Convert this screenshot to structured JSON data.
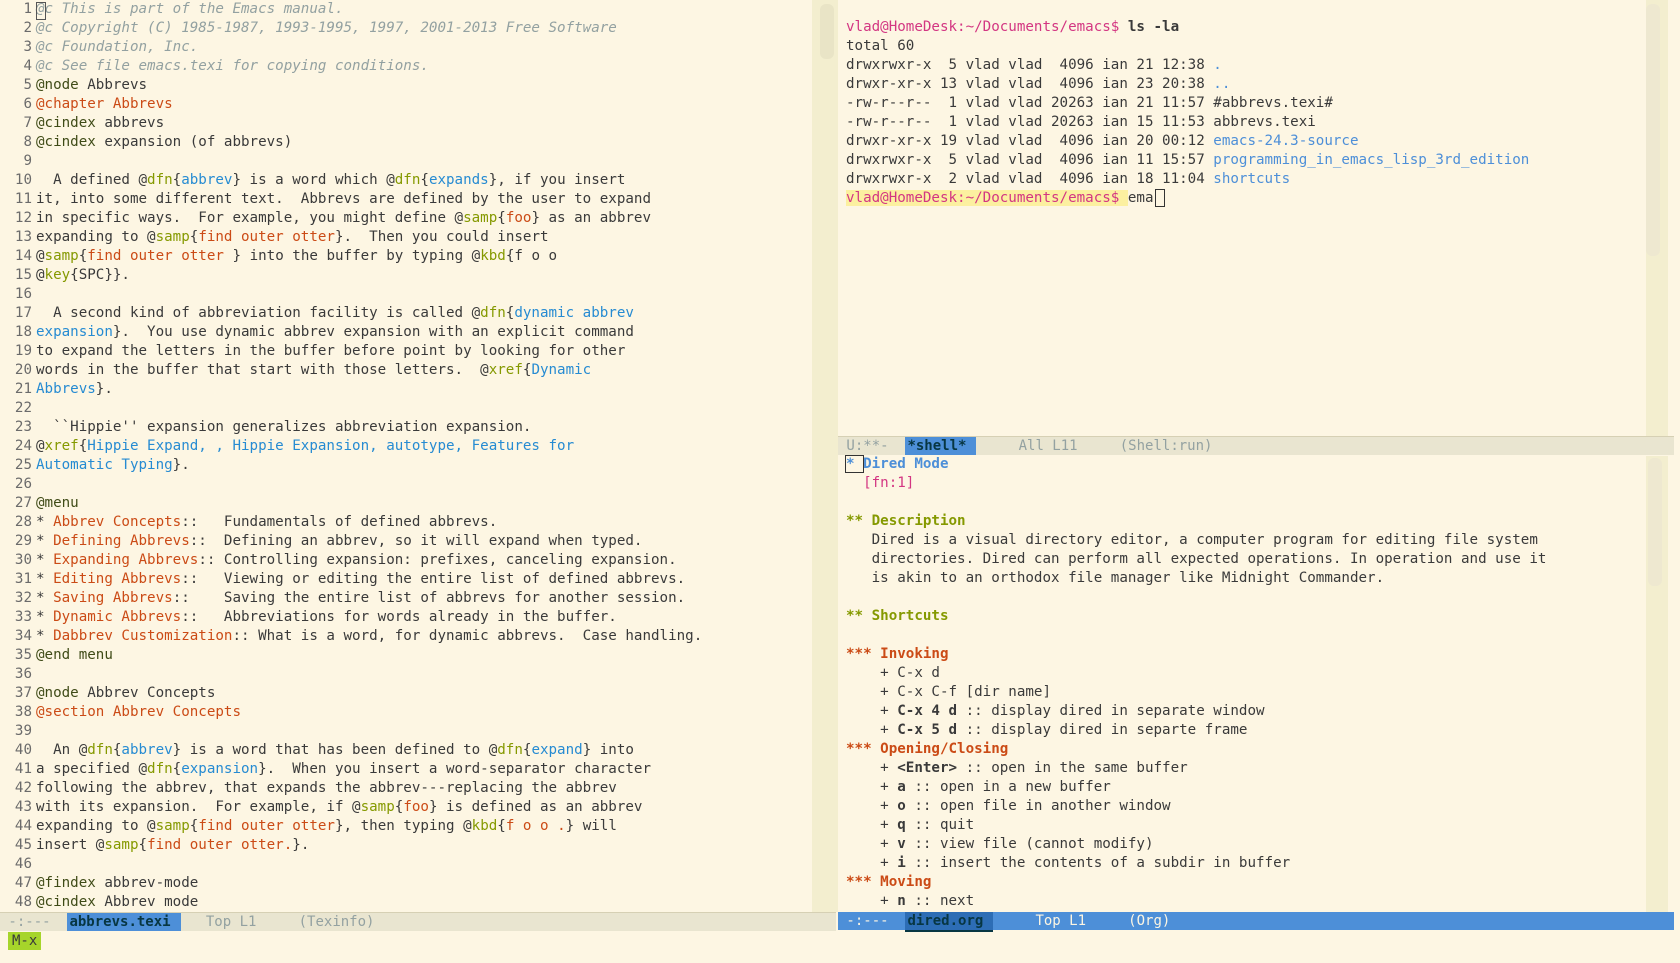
{
  "left_buffer": {
    "lines": [
      [
        {
          "t": "@c This is part of the Emacs manual.",
          "c": "c-comment"
        }
      ],
      [
        {
          "t": "@c Copyright (C) 1985-1987, 1993-1995, 1997, 2001-2013 Free Software",
          "c": "c-comment"
        }
      ],
      [
        {
          "t": "@c Foundation, Inc.",
          "c": "c-comment"
        }
      ],
      [
        {
          "t": "@c See file emacs.texi for copying conditions.",
          "c": "c-comment"
        }
      ],
      [
        {
          "t": "@node",
          "c": "c-kw"
        },
        {
          "t": " Abbrevs",
          "c": ""
        }
      ],
      [
        {
          "t": "@chapter Abbrevs",
          "c": "c-orange"
        }
      ],
      [
        {
          "t": "@cindex",
          "c": "c-kw"
        },
        {
          "t": " abbrevs",
          "c": ""
        }
      ],
      [
        {
          "t": "@cindex",
          "c": "c-kw"
        },
        {
          "t": " expansion (of abbrevs)",
          "c": ""
        }
      ],
      [
        {
          "t": "",
          "c": ""
        }
      ],
      [
        {
          "t": "  A defined @",
          "c": ""
        },
        {
          "t": "dfn",
          "c": "c-green"
        },
        {
          "t": "{",
          "c": ""
        },
        {
          "t": "abbrev",
          "c": "c-blue"
        },
        {
          "t": "} is a word which @",
          "c": ""
        },
        {
          "t": "dfn",
          "c": "c-green"
        },
        {
          "t": "{",
          "c": ""
        },
        {
          "t": "expands",
          "c": "c-blue"
        },
        {
          "t": "}, if you insert",
          "c": ""
        }
      ],
      [
        {
          "t": "it, into some different text.  Abbrevs are defined by the user to expand",
          "c": ""
        }
      ],
      [
        {
          "t": "in specific ways.  For example, you might define @",
          "c": ""
        },
        {
          "t": "samp",
          "c": "c-green"
        },
        {
          "t": "{",
          "c": ""
        },
        {
          "t": "foo",
          "c": "c-orange"
        },
        {
          "t": "} as an abbrev",
          "c": ""
        }
      ],
      [
        {
          "t": "expanding to @",
          "c": ""
        },
        {
          "t": "samp",
          "c": "c-green"
        },
        {
          "t": "{",
          "c": ""
        },
        {
          "t": "find outer otter",
          "c": "c-orange"
        },
        {
          "t": "}.  Then you could insert",
          "c": ""
        }
      ],
      [
        {
          "t": "@",
          "c": ""
        },
        {
          "t": "samp",
          "c": "c-green"
        },
        {
          "t": "{",
          "c": ""
        },
        {
          "t": "find outer otter ",
          "c": "c-orange"
        },
        {
          "t": "} into the buffer by typing @",
          "c": ""
        },
        {
          "t": "kbd",
          "c": "c-green"
        },
        {
          "t": "{f o o",
          "c": ""
        }
      ],
      [
        {
          "t": "@",
          "c": ""
        },
        {
          "t": "key",
          "c": "c-green"
        },
        {
          "t": "{SPC}}.",
          "c": ""
        }
      ],
      [
        {
          "t": "",
          "c": ""
        }
      ],
      [
        {
          "t": "  A second kind of abbreviation facility is called @",
          "c": ""
        },
        {
          "t": "dfn",
          "c": "c-green"
        },
        {
          "t": "{",
          "c": ""
        },
        {
          "t": "dynamic abbrev",
          "c": "c-blue"
        }
      ],
      [
        {
          "t": "expansion",
          "c": "c-blue"
        },
        {
          "t": "}.  You use dynamic abbrev expansion with an explicit command",
          "c": ""
        }
      ],
      [
        {
          "t": "to expand the letters in the buffer before point by looking for other",
          "c": ""
        }
      ],
      [
        {
          "t": "words in the buffer that start with those letters.  @",
          "c": ""
        },
        {
          "t": "xref",
          "c": "c-green"
        },
        {
          "t": "{",
          "c": ""
        },
        {
          "t": "Dynamic",
          "c": "c-blue"
        }
      ],
      [
        {
          "t": "Abbrevs",
          "c": "c-blue"
        },
        {
          "t": "}.",
          "c": ""
        }
      ],
      [
        {
          "t": "",
          "c": ""
        }
      ],
      [
        {
          "t": "  ``Hippie'' expansion generalizes abbreviation expansion.",
          "c": ""
        }
      ],
      [
        {
          "t": "@",
          "c": ""
        },
        {
          "t": "xref",
          "c": "c-green"
        },
        {
          "t": "{",
          "c": ""
        },
        {
          "t": "Hippie Expand, , Hippie Expansion, autotype, Features for",
          "c": "c-blue"
        }
      ],
      [
        {
          "t": "Automatic Typing",
          "c": "c-blue"
        },
        {
          "t": "}.",
          "c": ""
        }
      ],
      [
        {
          "t": "",
          "c": ""
        }
      ],
      [
        {
          "t": "@menu",
          "c": "c-kw"
        }
      ],
      [
        {
          "t": "* ",
          "c": ""
        },
        {
          "t": "Abbrev Concepts",
          "c": "c-orange"
        },
        {
          "t": "::   Fundamentals of defined abbrevs.",
          "c": ""
        }
      ],
      [
        {
          "t": "* ",
          "c": ""
        },
        {
          "t": "Defining Abbrevs",
          "c": "c-orange"
        },
        {
          "t": "::  Defining an abbrev, so it will expand when typed.",
          "c": ""
        }
      ],
      [
        {
          "t": "* ",
          "c": ""
        },
        {
          "t": "Expanding Abbrevs",
          "c": "c-orange"
        },
        {
          "t": ":: Controlling expansion: prefixes, canceling expansion.",
          "c": ""
        }
      ],
      [
        {
          "t": "* ",
          "c": ""
        },
        {
          "t": "Editing Abbrevs",
          "c": "c-orange"
        },
        {
          "t": "::   Viewing or editing the entire list of defined abbrevs.",
          "c": ""
        }
      ],
      [
        {
          "t": "* ",
          "c": ""
        },
        {
          "t": "Saving Abbrevs",
          "c": "c-orange"
        },
        {
          "t": "::    Saving the entire list of abbrevs for another session.",
          "c": ""
        }
      ],
      [
        {
          "t": "* ",
          "c": ""
        },
        {
          "t": "Dynamic Abbrevs",
          "c": "c-orange"
        },
        {
          "t": "::   Abbreviations for words already in the buffer.",
          "c": ""
        }
      ],
      [
        {
          "t": "* ",
          "c": ""
        },
        {
          "t": "Dabbrev Customization",
          "c": "c-orange"
        },
        {
          "t": ":: What is a word, for dynamic abbrevs.  Case handling.",
          "c": ""
        }
      ],
      [
        {
          "t": "@end menu",
          "c": "c-kw"
        }
      ],
      [
        {
          "t": "",
          "c": ""
        }
      ],
      [
        {
          "t": "@node",
          "c": "c-kw"
        },
        {
          "t": " Abbrev Concepts",
          "c": ""
        }
      ],
      [
        {
          "t": "@section Abbrev Concepts",
          "c": "c-orange"
        }
      ],
      [
        {
          "t": "",
          "c": ""
        }
      ],
      [
        {
          "t": "  An @",
          "c": ""
        },
        {
          "t": "dfn",
          "c": "c-green"
        },
        {
          "t": "{",
          "c": ""
        },
        {
          "t": "abbrev",
          "c": "c-blue"
        },
        {
          "t": "} is a word that has been defined to @",
          "c": ""
        },
        {
          "t": "dfn",
          "c": "c-green"
        },
        {
          "t": "{",
          "c": ""
        },
        {
          "t": "expand",
          "c": "c-blue"
        },
        {
          "t": "} into",
          "c": ""
        }
      ],
      [
        {
          "t": "a specified @",
          "c": ""
        },
        {
          "t": "dfn",
          "c": "c-green"
        },
        {
          "t": "{",
          "c": ""
        },
        {
          "t": "expansion",
          "c": "c-blue"
        },
        {
          "t": "}.  When you insert a word-separator character",
          "c": ""
        }
      ],
      [
        {
          "t": "following the abbrev, that expands the abbrev---replacing the abbrev",
          "c": ""
        }
      ],
      [
        {
          "t": "with its expansion.  For example, if @",
          "c": ""
        },
        {
          "t": "samp",
          "c": "c-green"
        },
        {
          "t": "{",
          "c": ""
        },
        {
          "t": "foo",
          "c": "c-orange"
        },
        {
          "t": "} is defined as an abbrev",
          "c": ""
        }
      ],
      [
        {
          "t": "expanding to @",
          "c": ""
        },
        {
          "t": "samp",
          "c": "c-green"
        },
        {
          "t": "{",
          "c": ""
        },
        {
          "t": "find outer otter",
          "c": "c-orange"
        },
        {
          "t": "}, then typing @",
          "c": ""
        },
        {
          "t": "kbd",
          "c": "c-green"
        },
        {
          "t": "{",
          "c": ""
        },
        {
          "t": "f o o .",
          "c": "c-orange"
        },
        {
          "t": "} will",
          "c": ""
        }
      ],
      [
        {
          "t": "insert @",
          "c": ""
        },
        {
          "t": "samp",
          "c": "c-green"
        },
        {
          "t": "{",
          "c": ""
        },
        {
          "t": "find outer otter.",
          "c": "c-orange"
        },
        {
          "t": "}.",
          "c": ""
        }
      ],
      [
        {
          "t": "",
          "c": ""
        }
      ],
      [
        {
          "t": "@findex",
          "c": "c-kw"
        },
        {
          "t": " abbrev-mode",
          "c": ""
        }
      ],
      [
        {
          "t": "@cindex",
          "c": "c-kw"
        },
        {
          "t": " Abbrev mode",
          "c": ""
        }
      ]
    ]
  },
  "left_modeline": {
    "state": " -:---  ",
    "buffer": "abbrevs.texi",
    "position": "   Top L1     ",
    "mode": "(Texinfo)"
  },
  "shell": {
    "prompt1": "vlad@HomeDesk:~/Documents/emacs$ ",
    "cmd1": "ls -la",
    "lines": [
      {
        "t": "total 60",
        "c": ""
      },
      {
        "t": "drwxrwxr-x  5 vlad vlad  4096 ian 21 12:38 ",
        "name": ".",
        "c": "c-dirblue"
      },
      {
        "t": "drwxr-xr-x 13 vlad vlad  4096 ian 23 20:38 ",
        "name": "..",
        "c": "c-dirblue"
      },
      {
        "t": "-rw-r--r--  1 vlad vlad 20263 ian 21 11:57 ",
        "name": "#abbrevs.texi#",
        "c": ""
      },
      {
        "t": "-rw-r--r--  1 vlad vlad 20263 ian 15 11:53 ",
        "name": "abbrevs.texi",
        "c": ""
      },
      {
        "t": "drwxr-xr-x 19 vlad vlad  4096 ian 20 00:12 ",
        "name": "emacs-24.3-source",
        "c": "c-dirblue"
      },
      {
        "t": "drwxrwxr-x  5 vlad vlad  4096 ian 11 15:57 ",
        "name": "programming_in_emacs_lisp_3rd_edition",
        "c": "c-dirblue"
      },
      {
        "t": "drwxrwxr-x  2 vlad vlad  4096 ian 18 11:04 ",
        "name": "shortcuts",
        "c": "c-dirblue"
      }
    ],
    "prompt2": "vlad@HomeDesk:~/Documents/emacs$ ",
    "input": "ema"
  },
  "shell_modeline": {
    "state": " U:**-  ",
    "buffer": "*shell*",
    "position": "     All L11     ",
    "mode": "(Shell:run)"
  },
  "dired_org": {
    "lines": [
      {
        "pre": "",
        "h": "* Dired Mode",
        "c": "org-h1"
      },
      {
        "pre": "  ",
        "h": "[fn:1]",
        "c": "c-magenta"
      },
      {
        "pre": "",
        "h": "",
        "c": ""
      },
      {
        "pre": "",
        "h": "** Description",
        "c": "org-h2"
      },
      {
        "pre": "   Dired is a visual directory editor, a computer program for editing file system",
        "h": "",
        "c": ""
      },
      {
        "pre": "   directories. Dired can perform all expected operations. In operation and use it",
        "h": "",
        "c": ""
      },
      {
        "pre": "   is akin to an orthodox file manager like Midnight Commander.",
        "h": "",
        "c": ""
      },
      {
        "pre": "",
        "h": "",
        "c": ""
      },
      {
        "pre": "",
        "h": "** Shortcuts",
        "c": "org-h2"
      },
      {
        "pre": "",
        "h": "",
        "c": ""
      },
      {
        "pre": "",
        "h": "*** Invoking",
        "c": "org-h3"
      },
      {
        "pre": "    + C-x d",
        "h": "",
        "c": ""
      },
      {
        "pre": "    + C-x C-f [dir name]",
        "h": "",
        "c": ""
      },
      {
        "pre": "    + ",
        "b": "C-x 4 d",
        "post": " :: display dired in separate window",
        "h": "",
        "c": ""
      },
      {
        "pre": "    + ",
        "b": "C-x 5 d",
        "post": " :: display dired in separte frame",
        "h": "",
        "c": ""
      },
      {
        "pre": "",
        "h": "*** Opening/Closing",
        "c": "org-h3"
      },
      {
        "pre": "    + ",
        "b": "<Enter>",
        "post": " :: open in the same buffer",
        "h": "",
        "c": ""
      },
      {
        "pre": "    + ",
        "b": "a",
        "post": " :: open in a new buffer",
        "h": "",
        "c": ""
      },
      {
        "pre": "    + ",
        "b": "o",
        "post": " :: open file in another window",
        "h": "",
        "c": ""
      },
      {
        "pre": "    + ",
        "b": "q",
        "post": " :: quit",
        "h": "",
        "c": ""
      },
      {
        "pre": "    + ",
        "b": "v",
        "post": " :: view file (cannot modify)",
        "h": "",
        "c": ""
      },
      {
        "pre": "    + ",
        "b": "i",
        "post": " :: insert the contents of a subdir in buffer",
        "h": "",
        "c": ""
      },
      {
        "pre": "",
        "h": "*** Moving",
        "c": "org-h3"
      },
      {
        "pre": "    + ",
        "b": "n",
        "post": " :: next",
        "h": "",
        "c": ""
      }
    ]
  },
  "dired_modeline": {
    "state": " -:---  ",
    "buffer": "dired.org",
    "position": "     Top L1     ",
    "mode": "(Org)"
  },
  "minibuffer": {
    "prompt": "M-x"
  }
}
